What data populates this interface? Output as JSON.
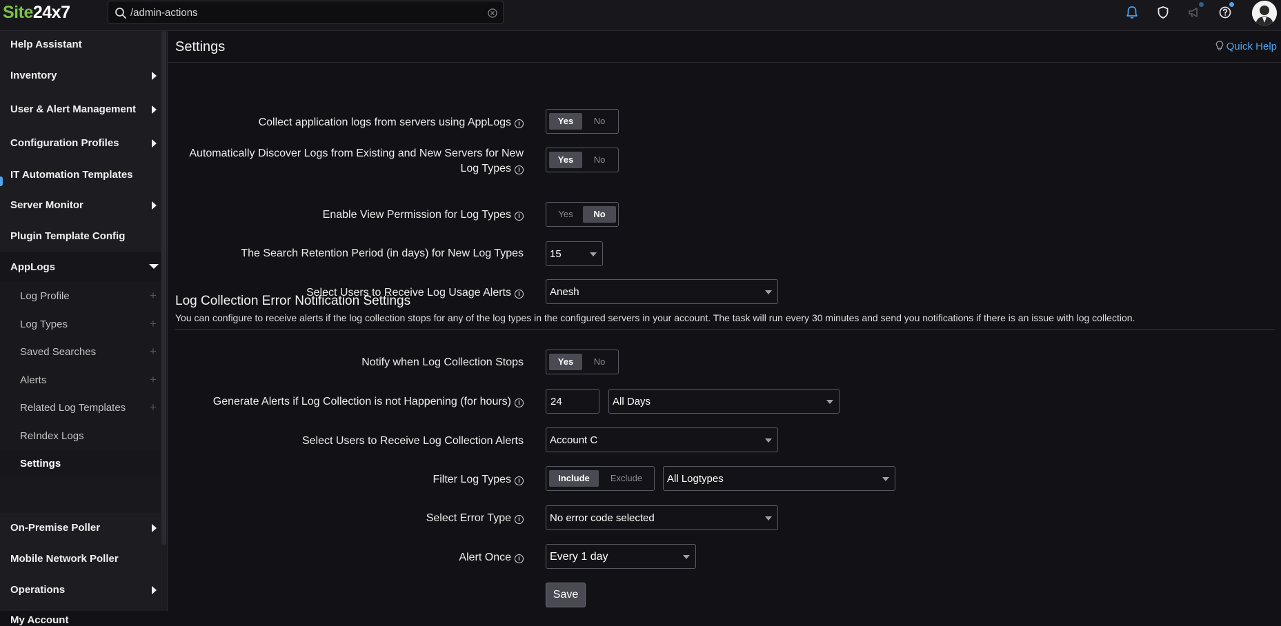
{
  "app": {
    "logo_part1": "Site",
    "logo_part2": "24x7"
  },
  "search": {
    "value": "/admin-actions"
  },
  "sidebar": {
    "items": [
      {
        "label": "Help Assistant"
      },
      {
        "label": "Inventory"
      },
      {
        "label": "User & Alert Management"
      },
      {
        "label": "Configuration Profiles"
      },
      {
        "label": "IT Automation Templates"
      },
      {
        "label": "Server Monitor"
      },
      {
        "label": "Plugin Template Config"
      },
      {
        "label": "AppLogs"
      },
      {
        "label": "On-Premise Poller"
      },
      {
        "label": "Mobile Network Poller"
      },
      {
        "label": "Operations"
      },
      {
        "label": "My Account"
      }
    ],
    "applogs_sub": [
      {
        "label": "Log Profile"
      },
      {
        "label": "Log Types"
      },
      {
        "label": "Saved Searches"
      },
      {
        "label": "Alerts"
      },
      {
        "label": "Related Log Templates"
      },
      {
        "label": "ReIndex Logs"
      },
      {
        "label": "Settings"
      }
    ],
    "plus": "+"
  },
  "page": {
    "title": "Settings",
    "quick_help": "Quick Help"
  },
  "settings": {
    "collect_logs": {
      "label": "Collect application logs from servers using AppLogs",
      "yes": "Yes",
      "no": "No",
      "selected": "Yes"
    },
    "auto_discover": {
      "label_line1": "Automatically Discover Logs from Existing and New Servers for New",
      "label_line2": "Log Types",
      "yes": "Yes",
      "no": "No",
      "selected": "Yes"
    },
    "view_permission": {
      "label": "Enable View Permission for Log Types",
      "yes": "Yes",
      "no": "No",
      "selected": "No"
    },
    "retention": {
      "label": "The Search Retention Period (in days) for New Log Types",
      "value": "15"
    },
    "usage_alert_users": {
      "label": "Select Users to Receive Log Usage Alerts",
      "value": "Anesh"
    }
  },
  "error_section": {
    "title": "Log Collection Error Notification Settings",
    "description": "You can configure to receive alerts if the log collection stops for any of the log types in the configured servers in your account. The task will run every 30 minutes and send you notifications if there is an issue with log collection.",
    "notify": {
      "label": "Notify when Log Collection Stops",
      "yes": "Yes",
      "no": "No",
      "selected": "Yes"
    },
    "generate_alerts": {
      "label": "Generate Alerts if Log Collection is not Happening (for hours)",
      "hours": "24",
      "days": "All Days"
    },
    "collection_alert_users": {
      "label": "Select Users to Receive Log Collection Alerts",
      "value": "Account C"
    },
    "filter": {
      "label": "Filter Log Types",
      "include": "Include",
      "exclude": "Exclude",
      "selected": "Include",
      "logtypes": "All Logtypes"
    },
    "error_type": {
      "label": "Select Error Type",
      "value": "No error code selected"
    },
    "alert_once": {
      "label": "Alert Once",
      "value": "Every 1 day"
    },
    "save": "Save"
  },
  "colors": {
    "accent": "#4ea4f0",
    "brand_green": "#7ac142",
    "background": "#121216"
  },
  "icons": [
    "search-icon",
    "clear-icon",
    "bell-icon",
    "shield-icon",
    "megaphone-icon",
    "help-icon",
    "avatar",
    "bulb-icon",
    "info-icon",
    "chevron-right-icon",
    "chevron-down-icon",
    "caret-down-icon",
    "plus-icon"
  ]
}
